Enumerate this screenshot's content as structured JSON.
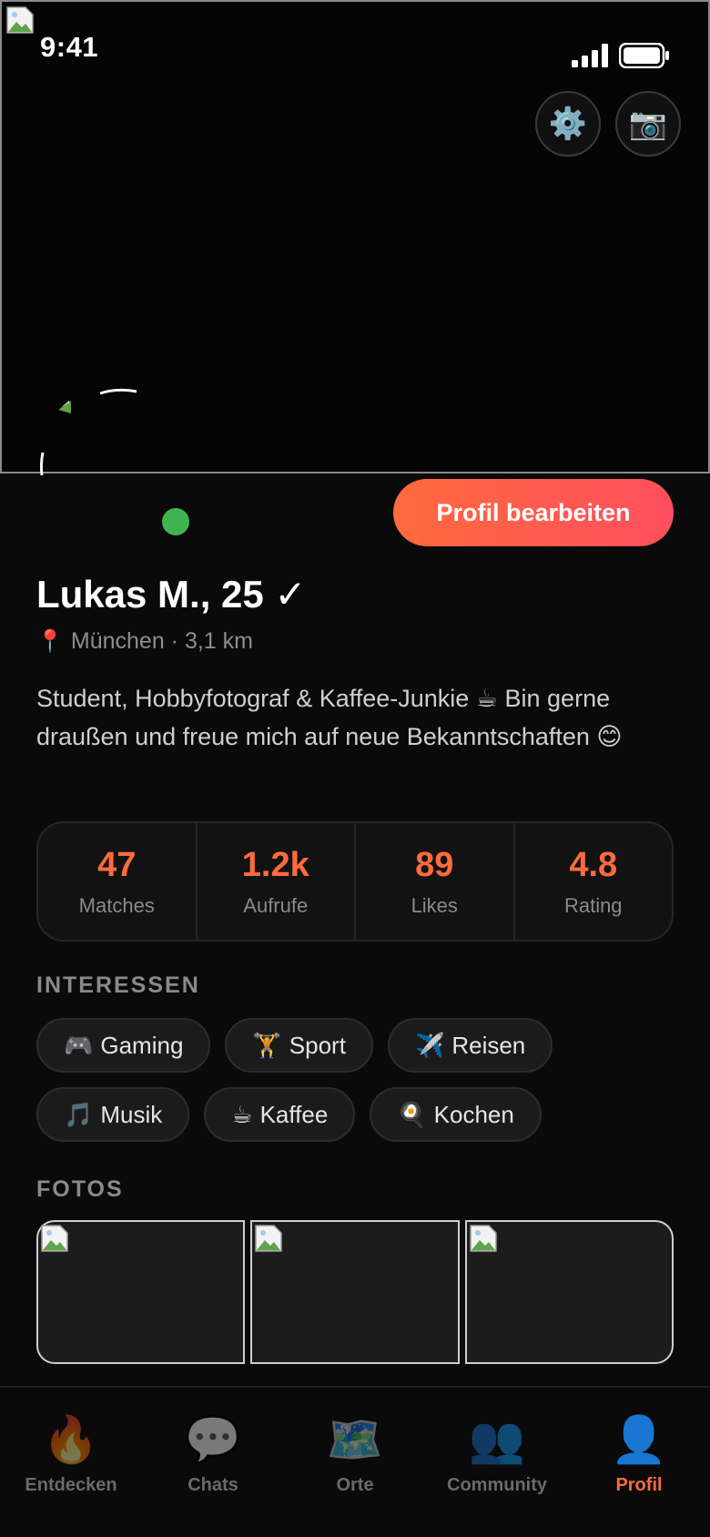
{
  "status_bar": {
    "time": "9:41"
  },
  "header": {
    "settings_icon": "⚙️",
    "camera_icon": "📷"
  },
  "profile": {
    "name": "Lukas M., 25 ✓",
    "pin_icon": "📍",
    "location": "München · 3,1 km",
    "bio": "Student, Hobbyfotograf & Kaffee-Junkie ☕ Bin gerne draußen und freue mich auf neue Bekanntschaften 😊",
    "edit_button": "Profil bearbeiten"
  },
  "stats": [
    {
      "value": "47",
      "label": "Matches"
    },
    {
      "value": "1.2k",
      "label": "Aufrufe"
    },
    {
      "value": "89",
      "label": "Likes"
    },
    {
      "value": "4.8",
      "label": "Rating"
    }
  ],
  "interests": {
    "title": "INTERESSEN",
    "items": [
      {
        "icon": "🎮",
        "label": "Gaming"
      },
      {
        "icon": "🏋️",
        "label": "Sport"
      },
      {
        "icon": "✈️",
        "label": "Reisen"
      },
      {
        "icon": "🎵",
        "label": "Musik"
      },
      {
        "icon": "☕",
        "label": "Kaffee"
      },
      {
        "icon": "🍳",
        "label": "Kochen"
      }
    ]
  },
  "photos": {
    "title": "FOTOS"
  },
  "tabbar": [
    {
      "icon": "🔥",
      "label": "Entdecken"
    },
    {
      "icon": "💬",
      "label": "Chats"
    },
    {
      "icon": "🗺️",
      "label": "Orte"
    },
    {
      "icon": "👥",
      "label": "Community"
    },
    {
      "icon": "👤",
      "label": "Profil"
    }
  ],
  "colors": {
    "accent": "#ff6b3d",
    "online": "#3fb34f",
    "background": "#0a0a0a"
  }
}
